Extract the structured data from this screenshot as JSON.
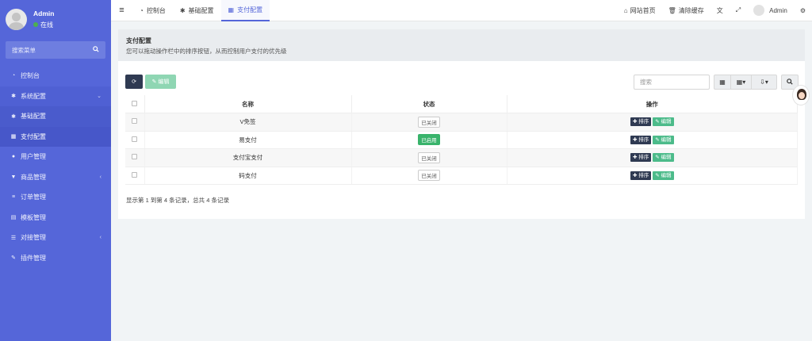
{
  "user": {
    "name": "Admin",
    "status": "在线"
  },
  "sidebar": {
    "search_placeholder": "搜索菜单",
    "items": [
      {
        "label": "控制台",
        "icon": "dashboard-icon"
      },
      {
        "label": "系统配置",
        "icon": "gear-icon"
      },
      {
        "label": "基础配置",
        "icon": "gear-icon"
      },
      {
        "label": "支付配置",
        "icon": "table-icon"
      },
      {
        "label": "用户管理",
        "icon": "user-icon"
      },
      {
        "label": "商品管理",
        "icon": "cart-icon"
      },
      {
        "label": "订单管理",
        "icon": "list-icon"
      },
      {
        "label": "模板管理",
        "icon": "template-icon"
      },
      {
        "label": "对接管理",
        "icon": "sliders-icon"
      },
      {
        "label": "插件管理",
        "icon": "plugin-icon"
      }
    ]
  },
  "topbar": {
    "tabs": [
      {
        "label": "控制台",
        "icon": "dashboard-icon"
      },
      {
        "label": "基础配置",
        "icon": "gear-icon"
      },
      {
        "label": "支付配置",
        "icon": "table-icon"
      }
    ],
    "home_label": "网站首页",
    "clear_cache_label": "清除缓存",
    "user_label": "Admin"
  },
  "header": {
    "title": "支付配置",
    "description": "您可以拖动操作栏中的排序按钮，从而控制用户支付的优先级"
  },
  "toolbar": {
    "edit_label": "编辑",
    "search_placeholder": "搜索"
  },
  "table": {
    "columns": [
      "名称",
      "状态",
      "操作"
    ],
    "rows": [
      {
        "name": "V免签",
        "status": "已关闭",
        "enabled": false
      },
      {
        "name": "易支付",
        "status": "已启用",
        "enabled": true
      },
      {
        "name": "支付宝支付",
        "status": "已关闭",
        "enabled": false
      },
      {
        "name": "码支付",
        "status": "已关闭",
        "enabled": false
      }
    ],
    "sort_label": "排序",
    "edit_label": "编辑"
  },
  "pagination_info": "显示第 1 到第 4 条记录，总共 4 条记录",
  "colors": {
    "sidebar": "#5566d9",
    "accent": "#5566d9",
    "enabled": "#39b36b",
    "edit": "#4cbb8a",
    "dark_button": "#2f3a52"
  }
}
